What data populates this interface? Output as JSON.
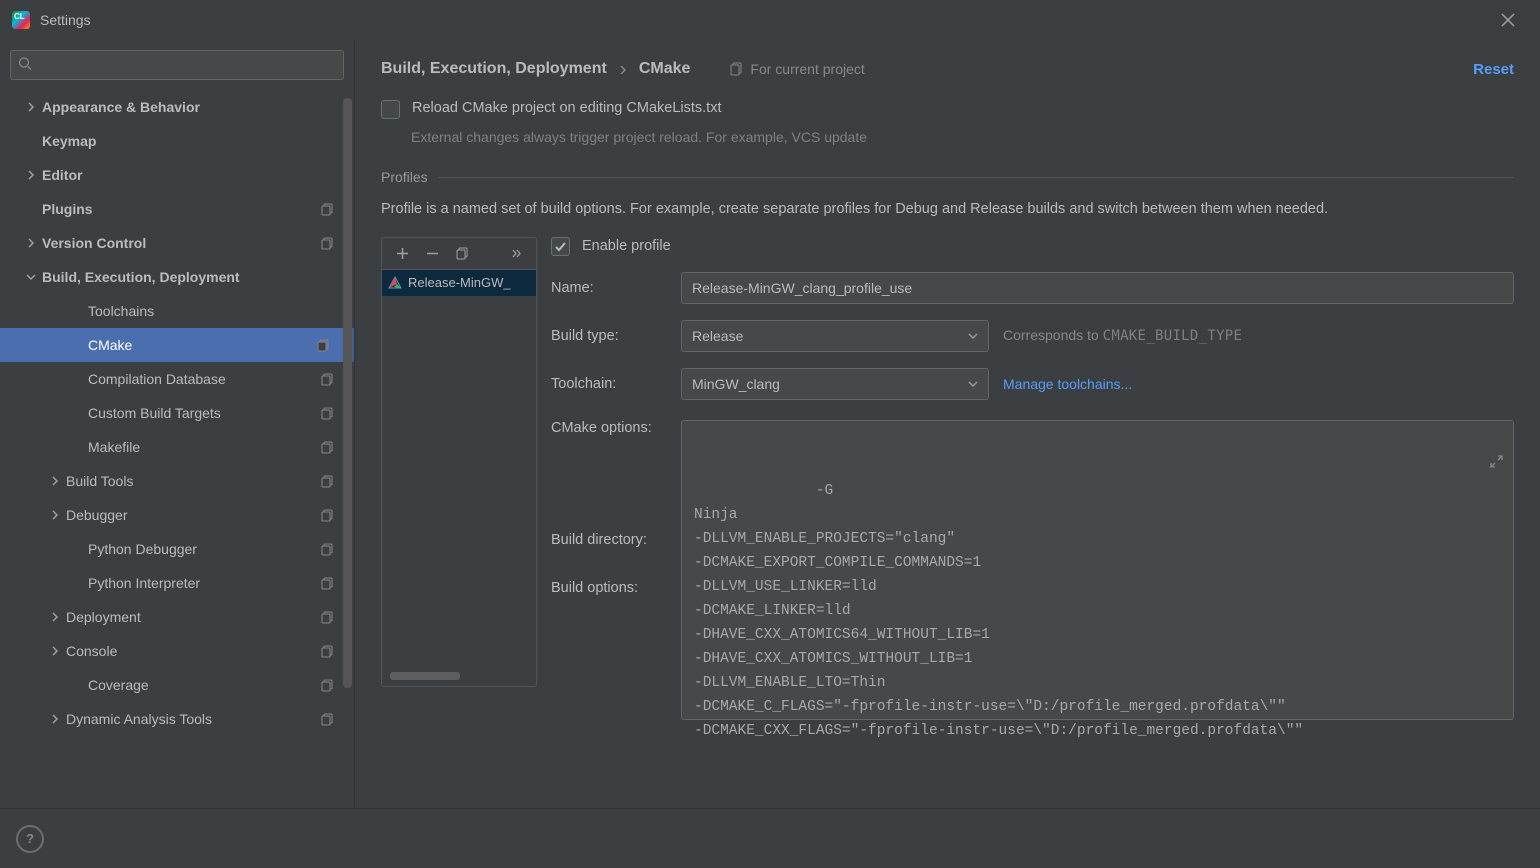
{
  "window": {
    "title": "Settings"
  },
  "search": {
    "placeholder": ""
  },
  "sidebar": {
    "items": [
      {
        "label": "Appearance & Behavior",
        "indent": 0,
        "bold": true,
        "arrow": "right",
        "copy": false
      },
      {
        "label": "Keymap",
        "indent": 0,
        "bold": true,
        "arrow": "",
        "copy": false
      },
      {
        "label": "Editor",
        "indent": 0,
        "bold": true,
        "arrow": "right",
        "copy": false
      },
      {
        "label": "Plugins",
        "indent": 0,
        "bold": true,
        "arrow": "",
        "copy": true
      },
      {
        "label": "Version Control",
        "indent": 0,
        "bold": true,
        "arrow": "right",
        "copy": true
      },
      {
        "label": "Build, Execution, Deployment",
        "indent": 0,
        "bold": true,
        "arrow": "down",
        "copy": false
      },
      {
        "label": "Toolchains",
        "indent": 2,
        "bold": false,
        "arrow": "",
        "copy": false
      },
      {
        "label": "CMake",
        "indent": 2,
        "bold": false,
        "arrow": "",
        "copy": true,
        "selected": true
      },
      {
        "label": "Compilation Database",
        "indent": 2,
        "bold": false,
        "arrow": "",
        "copy": true
      },
      {
        "label": "Custom Build Targets",
        "indent": 2,
        "bold": false,
        "arrow": "",
        "copy": true
      },
      {
        "label": "Makefile",
        "indent": 2,
        "bold": false,
        "arrow": "",
        "copy": true
      },
      {
        "label": "Build Tools",
        "indent": 1,
        "bold": false,
        "arrow": "right",
        "copy": true
      },
      {
        "label": "Debugger",
        "indent": 1,
        "bold": false,
        "arrow": "right",
        "copy": true
      },
      {
        "label": "Python Debugger",
        "indent": 2,
        "bold": false,
        "arrow": "",
        "copy": true
      },
      {
        "label": "Python Interpreter",
        "indent": 2,
        "bold": false,
        "arrow": "",
        "copy": true
      },
      {
        "label": "Deployment",
        "indent": 1,
        "bold": false,
        "arrow": "right",
        "copy": true
      },
      {
        "label": "Console",
        "indent": 1,
        "bold": false,
        "arrow": "right",
        "copy": true
      },
      {
        "label": "Coverage",
        "indent": 2,
        "bold": false,
        "arrow": "",
        "copy": true
      },
      {
        "label": "Dynamic Analysis Tools",
        "indent": 1,
        "bold": false,
        "arrow": "right",
        "copy": true
      }
    ]
  },
  "breadcrumb": {
    "parent": "Build, Execution, Deployment",
    "current": "CMake",
    "scope": "For current project"
  },
  "reset": "Reset",
  "reloadCheckbox": {
    "checked": false,
    "label": "Reload CMake project on editing CMakeLists.txt",
    "hint": "External changes always trigger project reload. For example, VCS update"
  },
  "profilesSection": {
    "title": "Profiles",
    "desc": "Profile is a named set of build options. For example, create separate profiles for Debug and Release builds and switch between them when needed.",
    "items": [
      {
        "label": "Release-MinGW_"
      }
    ]
  },
  "form": {
    "enable": {
      "label": "Enable profile",
      "checked": true
    },
    "name": {
      "label": "Name:",
      "value": "Release-MinGW_clang_profile_use"
    },
    "buildType": {
      "label": "Build type:",
      "value": "Release",
      "hintPrefix": "Corresponds to ",
      "hintMono": "CMAKE_BUILD_TYPE"
    },
    "toolchain": {
      "label": "Toolchain:",
      "value": "MinGW_clang",
      "manage": "Manage toolchains..."
    },
    "cmakeOptions": {
      "label": "CMake options:"
    },
    "buildDirectory": {
      "label": "Build directory:"
    },
    "buildOptions": {
      "label": "Build options:"
    },
    "cmakeText": "-G\nNinja\n-DLLVM_ENABLE_PROJECTS=\"clang\"\n-DCMAKE_EXPORT_COMPILE_COMMANDS=1\n-DLLVM_USE_LINKER=lld\n-DCMAKE_LINKER=lld\n-DHAVE_CXX_ATOMICS64_WITHOUT_LIB=1\n-DHAVE_CXX_ATOMICS_WITHOUT_LIB=1\n-DLLVM_ENABLE_LTO=Thin\n-DCMAKE_C_FLAGS=\"-fprofile-instr-use=\\\"D:/profile_merged.profdata\\\"\"\n-DCMAKE_CXX_FLAGS=\"-fprofile-instr-use=\\\"D:/profile_merged.profdata\\\"\""
  }
}
